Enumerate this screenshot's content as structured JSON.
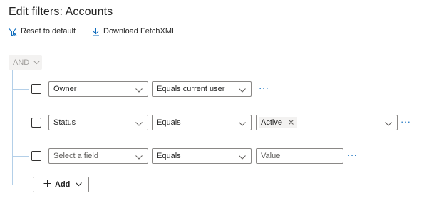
{
  "dialog": {
    "title": "Edit filters: Accounts"
  },
  "commands": {
    "reset_label": "Reset to default",
    "download_label": "Download FetchXML"
  },
  "group": {
    "operator": "AND"
  },
  "rows": [
    {
      "field": "Owner",
      "operator": "Equals current user",
      "value_type": "none"
    },
    {
      "field": "Status",
      "operator": "Equals",
      "value_type": "multiselect",
      "value_tags": [
        "Active"
      ]
    },
    {
      "field_placeholder": "Select a field",
      "operator": "Equals",
      "value_type": "text",
      "value_placeholder": "Value"
    }
  ],
  "more_glyph": "···",
  "add_button": {
    "label": "Add"
  },
  "colors": {
    "accent": "#0f6cbd",
    "tree_line": "#b3cfe8",
    "border": "#8a8886"
  },
  "icons": [
    "filter-reset-icon",
    "download-icon",
    "chevron-down-icon",
    "close-icon",
    "plus-icon",
    "more-icon"
  ]
}
